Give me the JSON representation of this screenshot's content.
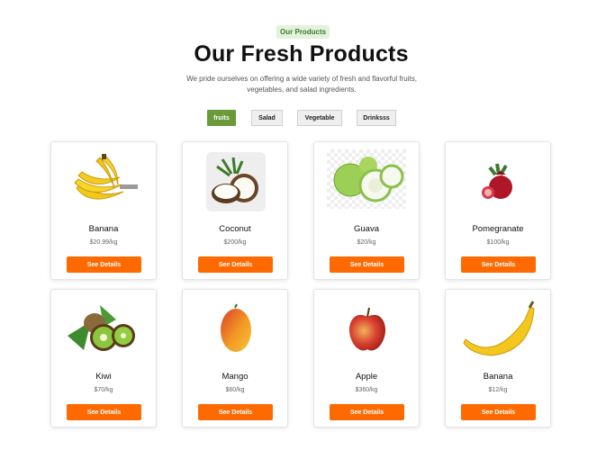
{
  "header": {
    "badge": "Our Products",
    "title": "Our Fresh Products",
    "subtitle": "We pride ourselves on offering a wide variety of fresh and flavorful fruits, vegetables, and salad ingredients."
  },
  "filters": [
    {
      "label": "fruits",
      "active": true
    },
    {
      "label": "Salad",
      "active": false
    },
    {
      "label": "Vegetable",
      "active": false
    },
    {
      "label": "Drinksss",
      "active": false
    }
  ],
  "products": [
    {
      "name": "Banana",
      "price": "$20.99/kg",
      "button": "See Details",
      "icon": "banana-bunch-image"
    },
    {
      "name": "Coconut",
      "price": "$200/kg",
      "button": "See Details",
      "icon": "coconut-image"
    },
    {
      "name": "Guava",
      "price": "$20/kg",
      "button": "See Details",
      "icon": "guava-image"
    },
    {
      "name": "Pomegranate",
      "price": "$100/kg",
      "button": "See Details",
      "icon": "pomegranate-image"
    },
    {
      "name": "Kiwi",
      "price": "$70/kg",
      "button": "See Details",
      "icon": "kiwi-image"
    },
    {
      "name": "Mango",
      "price": "$60/kg",
      "button": "See Details",
      "icon": "mango-image"
    },
    {
      "name": "Apple",
      "price": "$360/kg",
      "button": "See Details",
      "icon": "apple-image"
    },
    {
      "name": "Banana",
      "price": "$12/kg",
      "button": "See Details",
      "icon": "banana-image"
    }
  ],
  "colors": {
    "accent": "#ff6a00",
    "filter_active": "#6a9a3a",
    "badge_bg": "#e3f2dc",
    "badge_text": "#3c7a2c"
  }
}
